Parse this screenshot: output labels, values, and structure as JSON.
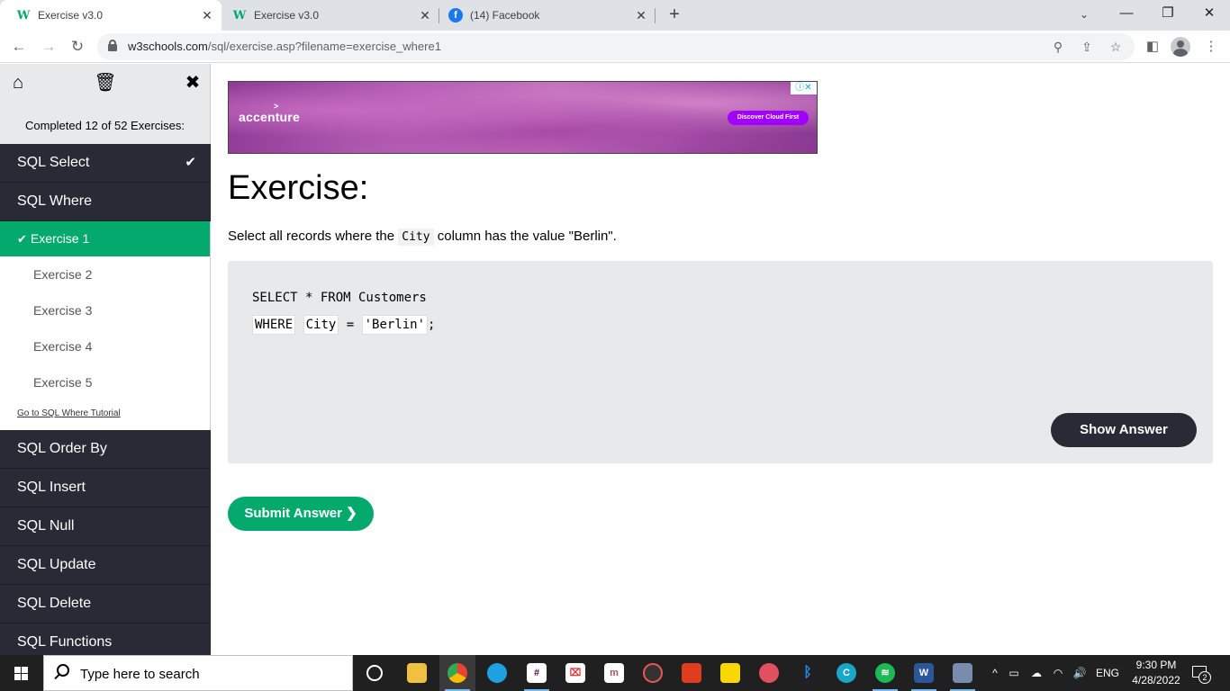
{
  "browser": {
    "tabs": [
      {
        "title": "Exercise v3.0",
        "favicon": "w3schools-icon",
        "active": true
      },
      {
        "title": "Exercise v3.0",
        "favicon": "w3schools-icon",
        "active": false
      },
      {
        "title": "(14) Facebook",
        "favicon": "facebook-icon",
        "active": false
      }
    ],
    "url_host": "w3schools.com",
    "url_path": "/sql/exercise.asp?filename=exercise_where1"
  },
  "sidebar": {
    "progress": "Completed 12 of 52 Exercises:",
    "chapters_before": [
      {
        "label": "SQL Select",
        "completed": true
      },
      {
        "label": "SQL Where",
        "completed": false
      }
    ],
    "exercises": [
      {
        "label": "Exercise 1",
        "active": true
      },
      {
        "label": "Exercise 2",
        "active": false
      },
      {
        "label": "Exercise 3",
        "active": false
      },
      {
        "label": "Exercise 4",
        "active": false
      },
      {
        "label": "Exercise 5",
        "active": false
      }
    ],
    "tutorial_link": "Go to SQL Where Tutorial",
    "chapters_after": [
      "SQL Order By",
      "SQL Insert",
      "SQL Null",
      "SQL Update",
      "SQL Delete",
      "SQL Functions"
    ]
  },
  "ad": {
    "brand": "accenture",
    "cta": "Discover Cloud First"
  },
  "main": {
    "heading": "Exercise:",
    "instruction_before": "Select all records where the ",
    "instruction_code": "City",
    "instruction_after": " column has the value \"Berlin\".",
    "code_line1": "SELECT * FROM Customers",
    "blank1_value": "WHERE",
    "blank2_value": "City",
    "code_eq": " = ",
    "blank3_value": "'Berlin'",
    "code_end": ";",
    "show_answer": "Show Answer",
    "submit": "Submit Answer ❯"
  },
  "taskbar": {
    "search_placeholder": "Type here to search",
    "language": "ENG",
    "time": "9:30 PM",
    "date": "4/28/2022",
    "notification_count": "2"
  },
  "colors": {
    "accent_green": "#04aa6d",
    "sidebar_dark": "#282a35",
    "code_bg": "#e7e9eb"
  }
}
